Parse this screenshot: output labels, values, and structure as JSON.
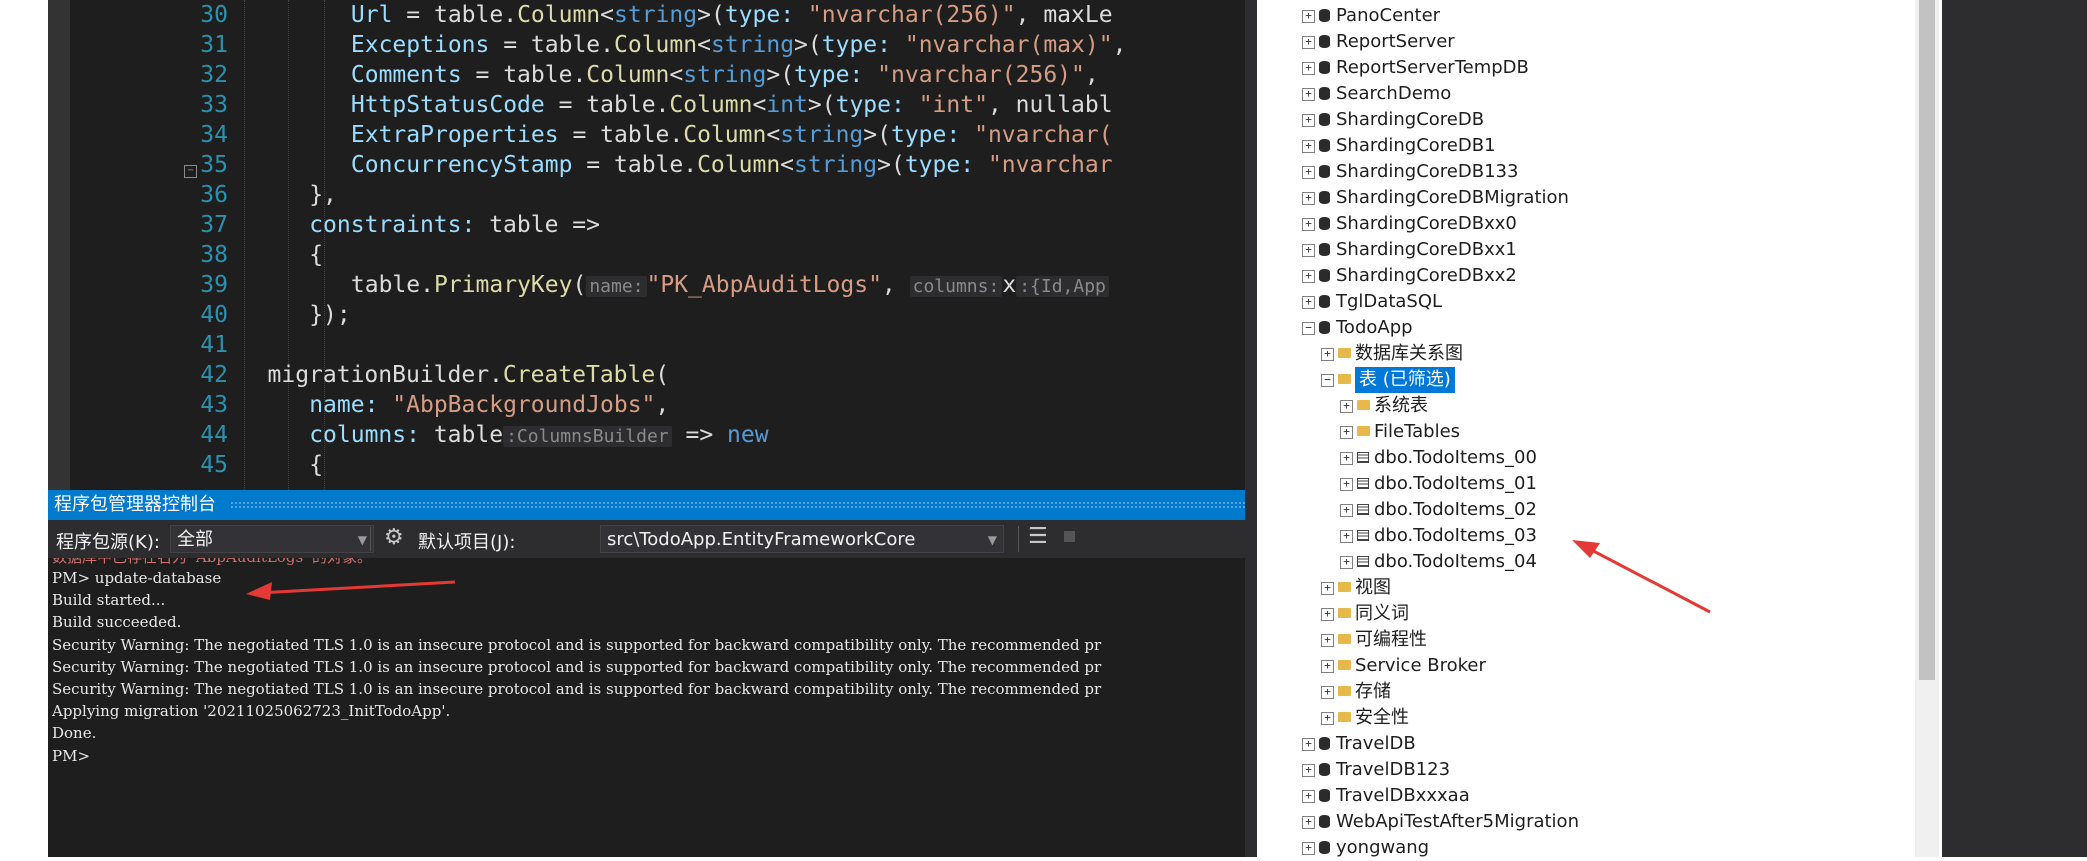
{
  "editor": {
    "lines": [
      {
        "n": "30",
        "segs": [
          {
            "t": "Url",
            "c": "t-param"
          },
          {
            "t": " = table.",
            "c": "t-prop"
          },
          {
            "t": "Column",
            "c": "t-meth"
          },
          {
            "t": "<",
            "c": "t-prop"
          },
          {
            "t": "string",
            "c": "t-kw"
          },
          {
            "t": ">(",
            "c": "t-prop"
          },
          {
            "t": "type:",
            "c": "t-param"
          },
          {
            "t": " ",
            "c": "t-prop"
          },
          {
            "t": "\"nvarchar(256)\"",
            "c": "t-str"
          },
          {
            "t": ", maxLe",
            "c": "t-prop"
          }
        ]
      },
      {
        "n": "31",
        "segs": [
          {
            "t": "Exceptions",
            "c": "t-param"
          },
          {
            "t": " = table.",
            "c": "t-prop"
          },
          {
            "t": "Column",
            "c": "t-meth"
          },
          {
            "t": "<",
            "c": "t-prop"
          },
          {
            "t": "string",
            "c": "t-kw"
          },
          {
            "t": ">(",
            "c": "t-prop"
          },
          {
            "t": "type:",
            "c": "t-param"
          },
          {
            "t": " ",
            "c": "t-prop"
          },
          {
            "t": "\"nvarchar(max)\"",
            "c": "t-str"
          },
          {
            "t": ",",
            "c": "t-prop"
          }
        ]
      },
      {
        "n": "32",
        "segs": [
          {
            "t": "Comments",
            "c": "t-param"
          },
          {
            "t": " = table.",
            "c": "t-prop"
          },
          {
            "t": "Column",
            "c": "t-meth"
          },
          {
            "t": "<",
            "c": "t-prop"
          },
          {
            "t": "string",
            "c": "t-kw"
          },
          {
            "t": ">(",
            "c": "t-prop"
          },
          {
            "t": "type:",
            "c": "t-param"
          },
          {
            "t": " ",
            "c": "t-prop"
          },
          {
            "t": "\"nvarchar(256)\"",
            "c": "t-str"
          },
          {
            "t": ",",
            "c": "t-prop"
          }
        ]
      },
      {
        "n": "33",
        "segs": [
          {
            "t": "HttpStatusCode",
            "c": "t-param"
          },
          {
            "t": " = table.",
            "c": "t-prop"
          },
          {
            "t": "Column",
            "c": "t-meth"
          },
          {
            "t": "<",
            "c": "t-prop"
          },
          {
            "t": "int",
            "c": "t-kw"
          },
          {
            "t": ">(",
            "c": "t-prop"
          },
          {
            "t": "type:",
            "c": "t-param"
          },
          {
            "t": " ",
            "c": "t-prop"
          },
          {
            "t": "\"int\"",
            "c": "t-str"
          },
          {
            "t": ", nullabl",
            "c": "t-prop"
          }
        ]
      },
      {
        "n": "34",
        "segs": [
          {
            "t": "ExtraProperties",
            "c": "t-param"
          },
          {
            "t": " = table.",
            "c": "t-prop"
          },
          {
            "t": "Column",
            "c": "t-meth"
          },
          {
            "t": "<",
            "c": "t-prop"
          },
          {
            "t": "string",
            "c": "t-kw"
          },
          {
            "t": ">(",
            "c": "t-prop"
          },
          {
            "t": "type:",
            "c": "t-param"
          },
          {
            "t": " ",
            "c": "t-prop"
          },
          {
            "t": "\"nvarchar(",
            "c": "t-str"
          }
        ]
      },
      {
        "n": "35",
        "segs": [
          {
            "t": "ConcurrencyStamp",
            "c": "t-param"
          },
          {
            "t": " = table.",
            "c": "t-prop"
          },
          {
            "t": "Column",
            "c": "t-meth"
          },
          {
            "t": "<",
            "c": "t-prop"
          },
          {
            "t": "string",
            "c": "t-kw"
          },
          {
            "t": ">(",
            "c": "t-prop"
          },
          {
            "t": "type:",
            "c": "t-param"
          },
          {
            "t": " ",
            "c": "t-prop"
          },
          {
            "t": "\"nvarchar",
            "c": "t-str"
          }
        ]
      },
      {
        "n": "36",
        "segs": [
          {
            "t": "},",
            "c": "t-prop"
          }
        ]
      },
      {
        "n": "37",
        "segs": [
          {
            "t": "constraints:",
            "c": "t-param"
          },
          {
            "t": " table =>",
            "c": "t-prop"
          }
        ]
      },
      {
        "n": "38",
        "segs": [
          {
            "t": "{",
            "c": "t-prop"
          }
        ]
      },
      {
        "n": "39",
        "segs": [
          {
            "t": "table.",
            "c": "t-prop"
          },
          {
            "t": "PrimaryKey",
            "c": "t-meth"
          },
          {
            "t": "(",
            "c": "t-prop"
          },
          {
            "t": "name:",
            "c": "t-hint"
          },
          {
            "t": "\"PK_AbpAuditLogs\"",
            "c": "t-str"
          },
          {
            "t": ", ",
            "c": "t-prop"
          },
          {
            "t": "columns:",
            "c": "t-hint"
          },
          {
            "t": "x",
            "c": "t-prop"
          },
          {
            "t": ":{Id,App",
            "c": "t-hint"
          }
        ]
      },
      {
        "n": "40",
        "segs": [
          {
            "t": "});",
            "c": "t-prop"
          }
        ]
      },
      {
        "n": "41",
        "segs": []
      },
      {
        "n": "42",
        "segs": [
          {
            "t": "migrationBuilder.",
            "c": "t-prop"
          },
          {
            "t": "CreateTable",
            "c": "t-meth"
          },
          {
            "t": "(",
            "c": "t-prop"
          }
        ]
      },
      {
        "n": "43",
        "segs": [
          {
            "t": "name:",
            "c": "t-param"
          },
          {
            "t": " ",
            "c": "t-prop"
          },
          {
            "t": "\"AbpBackgroundJobs\"",
            "c": "t-str"
          },
          {
            "t": ",",
            "c": "t-prop"
          }
        ]
      },
      {
        "n": "44",
        "segs": [
          {
            "t": "columns:",
            "c": "t-param"
          },
          {
            "t": " table",
            "c": "t-prop"
          },
          {
            "t": ":ColumnsBuilder",
            "c": "t-hint"
          },
          {
            "t": " => ",
            "c": "t-prop"
          },
          {
            "t": "new",
            "c": "t-kw"
          }
        ]
      },
      {
        "n": "45",
        "segs": [
          {
            "t": "{",
            "c": "t-prop"
          }
        ]
      }
    ]
  },
  "pmc": {
    "title": "程序包管理器控制台",
    "source_label": "程序包源(K):",
    "source_value": "全部",
    "default_project_label": "默认项目(J):",
    "default_project_value": "src\\TodoApp.EntityFrameworkCore",
    "output": [
      "PM> update-database",
      "Build started...",
      "Build succeeded.",
      "Security Warning: The negotiated TLS 1.0 is an insecure protocol and is supported for backward compatibility only. The recommended pr",
      "Security Warning: The negotiated TLS 1.0 is an insecure protocol and is supported for backward compatibility only. The recommended pr",
      "Security Warning: The negotiated TLS 1.0 is an insecure protocol and is supported for backward compatibility only. The recommended pr",
      "Applying migration '20211025062723_InitTodoApp'.",
      "Done.",
      "PM>"
    ]
  },
  "explorer": {
    "items": [
      {
        "label": "PanoCenter",
        "icon": "database-icon",
        "level": 0,
        "expander": "+"
      },
      {
        "label": "ReportServer",
        "icon": "database-icon",
        "level": 0,
        "expander": "+"
      },
      {
        "label": "ReportServerTempDB",
        "icon": "database-icon",
        "level": 0,
        "expander": "+"
      },
      {
        "label": "SearchDemo",
        "icon": "database-icon",
        "level": 0,
        "expander": "+"
      },
      {
        "label": "ShardingCoreDB",
        "icon": "database-icon",
        "level": 0,
        "expander": "+"
      },
      {
        "label": "ShardingCoreDB1",
        "icon": "database-icon",
        "level": 0,
        "expander": "+"
      },
      {
        "label": "ShardingCoreDB133",
        "icon": "database-icon",
        "level": 0,
        "expander": "+"
      },
      {
        "label": "ShardingCoreDBMigration",
        "icon": "database-icon",
        "level": 0,
        "expander": "+"
      },
      {
        "label": "ShardingCoreDBxx0",
        "icon": "database-icon",
        "level": 0,
        "expander": "+"
      },
      {
        "label": "ShardingCoreDBxx1",
        "icon": "database-icon",
        "level": 0,
        "expander": "+"
      },
      {
        "label": "ShardingCoreDBxx2",
        "icon": "database-icon",
        "level": 0,
        "expander": "+"
      },
      {
        "label": "TglDataSQL",
        "icon": "database-icon",
        "level": 0,
        "expander": "+"
      },
      {
        "label": "TodoApp",
        "icon": "database-icon",
        "level": 0,
        "expander": "−"
      },
      {
        "label": "数据库关系图",
        "icon": "folder-icon",
        "level": 1,
        "expander": "+"
      },
      {
        "label": "表 (已筛选)",
        "icon": "folder-icon",
        "level": 1,
        "expander": "−",
        "selected": true
      },
      {
        "label": "系统表",
        "icon": "folder-icon",
        "level": 2,
        "expander": "+"
      },
      {
        "label": "FileTables",
        "icon": "folder-icon",
        "level": 2,
        "expander": "+"
      },
      {
        "label": "dbo.TodoItems_00",
        "icon": "table-icon",
        "level": 2,
        "expander": "+"
      },
      {
        "label": "dbo.TodoItems_01",
        "icon": "table-icon",
        "level": 2,
        "expander": "+"
      },
      {
        "label": "dbo.TodoItems_02",
        "icon": "table-icon",
        "level": 2,
        "expander": "+"
      },
      {
        "label": "dbo.TodoItems_03",
        "icon": "table-icon",
        "level": 2,
        "expander": "+"
      },
      {
        "label": "dbo.TodoItems_04",
        "icon": "table-icon",
        "level": 2,
        "expander": "+"
      },
      {
        "label": "视图",
        "icon": "folder-icon",
        "level": 1,
        "expander": "+"
      },
      {
        "label": "同义词",
        "icon": "folder-icon",
        "level": 1,
        "expander": "+"
      },
      {
        "label": "可编程性",
        "icon": "folder-icon",
        "level": 1,
        "expander": "+"
      },
      {
        "label": "Service Broker",
        "icon": "folder-icon",
        "level": 1,
        "expander": "+"
      },
      {
        "label": "存储",
        "icon": "folder-icon",
        "level": 1,
        "expander": "+"
      },
      {
        "label": "安全性",
        "icon": "folder-icon",
        "level": 1,
        "expander": "+"
      },
      {
        "label": "TravelDB",
        "icon": "database-icon",
        "level": 0,
        "expander": "+"
      },
      {
        "label": "TravelDB123",
        "icon": "database-icon",
        "level": 0,
        "expander": "+"
      },
      {
        "label": "TravelDBxxxaa",
        "icon": "database-icon",
        "level": 0,
        "expander": "+"
      },
      {
        "label": "WebApiTestAfter5Migration",
        "icon": "database-icon",
        "level": 0,
        "expander": "+"
      },
      {
        "label": "yongwang",
        "icon": "database-icon",
        "level": 0,
        "expander": "+"
      }
    ]
  },
  "colors": {
    "annotation_arrow": "#e53935",
    "selection": "#0078d7",
    "console_title": "#007acc"
  }
}
